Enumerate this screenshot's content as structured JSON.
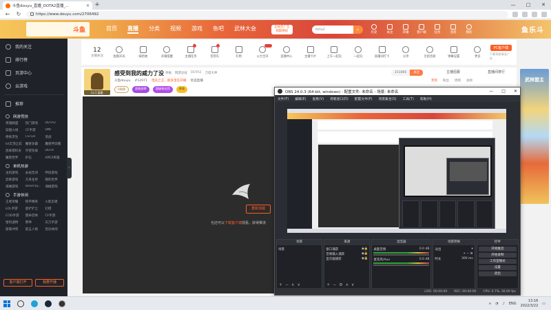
{
  "browser": {
    "tab_title": "斗鱼douyu_直播_DOTA2直播_...",
    "url": "https://www.douyu.com/2706492",
    "window_controls": [
      "—",
      "□",
      "✕"
    ]
  },
  "header": {
    "logo": "斗鱼",
    "nav": [
      "首页",
      "直播",
      "分类",
      "视频",
      "游戏",
      "鱼吧",
      "武林大会"
    ],
    "nav_active": 1,
    "download_badge": [
      "全站无广告",
      "领取特权"
    ],
    "search_placeholder": "dota2",
    "icons": [
      "历史",
      "关注",
      "开播",
      "客户端",
      "任务",
      "消息",
      "我的"
    ],
    "promo": "鱼乐斗"
  },
  "sidebar": {
    "main": [
      "我的关注",
      "排行榜",
      "页游中心",
      "云游戏"
    ],
    "section_hot": "推荐",
    "section1": "网游竞技",
    "grid1": [
      "英雄联盟",
      "热门游戏",
      "DOTA2",
      "穿越火线",
      "CF手游",
      "DNF",
      "绝地求生",
      "CS:GO",
      "逆战",
      "lol云顶之弈",
      "魔兽争霸",
      "魔兽怀旧服",
      "逃离塔科夫",
      "守望先锋",
      "DOTA",
      "魔兽世界",
      "炉石",
      "APEX英雄"
    ],
    "section2": "单机热游",
    "grid2": [
      "主机游戏",
      "永劫无间",
      "怀旧游戏",
      "恐怖游戏",
      "方舟生存",
      "我的世界",
      "海贼游戏",
      "Dead by...",
      "海贼游戏"
    ],
    "section3": "手游休闲",
    "grid3": [
      "王者荣耀",
      "和平精英",
      "火影忍者",
      "LOL手游",
      "金铲铲之",
      "幻塔",
      "COD手游",
      "使命召唤",
      "CF手游",
      "哈利波特",
      "原神",
      "天刀手游",
      "部落冲突",
      "第五人格",
      "音乐休闲"
    ],
    "btn_client": "客户端打开",
    "btn_open": "我要开播"
  },
  "toolbar": {
    "follow_count": "12",
    "follow_label": "主播关注",
    "items": [
      "鱼粮开光",
      "嫁给她",
      "开播提醒",
      "主播任务",
      "签到礼",
      "礼物",
      "火力全开",
      "追播中心",
      "主播卡片",
      "上车一起玩",
      "一起玩",
      "直播间打卡",
      "分享",
      "无损音质",
      "弹幕设置",
      "更多"
    ],
    "pc_btn": "PC客户端",
    "pc_sub": "下载享超清无广告"
  },
  "room": {
    "title": "感受到我的威力了没",
    "tags": [
      "举报",
      "网游竞技",
      "DOTA2",
      "刀塔大神"
    ],
    "anchor_name": "斗鱼douyu",
    "hot": "#12971",
    "notice": "电竞之王、颜多宝在开播",
    "tags2": [
      "优选直播"
    ],
    "level": "Lv.1 英雄",
    "badges": [
      "0周榜",
      "超能勋章",
      "超级粉丝团",
      "贵族"
    ],
    "follow_num": "211005",
    "follow_act": "关注",
    "report": "主播招募",
    "rank": "直播间排行"
  },
  "rank_tabs": [
    "贵宾",
    "粉丝",
    "周榜",
    "总榜"
  ],
  "player": {
    "reload": "重新加载",
    "hint_pre": "也还可以",
    "hint_link": "下载客户端",
    "hint_post": "观看，获得推流"
  },
  "right_ad": "武林盟主",
  "obs": {
    "title": "OBS 24.0.3 (64-bit, windows) - 配置文件: 未命名 - 场景: 未命名",
    "menu": [
      "文件(F)",
      "编辑(E)",
      "查看(V)",
      "停靠窗口(D)",
      "配置文件(P)",
      "场景集合(S)",
      "工具(T)",
      "帮助(H)"
    ],
    "docks": {
      "scenes": "场景",
      "scene_item": "场景",
      "sources": "来源",
      "source_items": [
        "窗口捕获",
        "音频输入捕获",
        "显示器捕获"
      ],
      "mixer": "混音器",
      "mixer_items": [
        "桌面音频",
        "麦克风/Aux"
      ],
      "mixer_db": [
        "0.0 dB",
        "0.0 dB"
      ],
      "transitions": "场景转换",
      "transition_mode": "淡出",
      "duration_label": "时长",
      "duration_value": "300 ms",
      "controls": "控件",
      "control_btns": [
        "开始推流",
        "开始录制",
        "工作室模式",
        "设置",
        "退出"
      ]
    },
    "status": [
      "LIVE: 00:00:00",
      "REC: 00:00:00",
      "CPU: 0.7%, 30.00 fps"
    ]
  },
  "taskbar": {
    "tray_lang": "ENG",
    "time": "13:16",
    "date": "2022/3/22"
  }
}
